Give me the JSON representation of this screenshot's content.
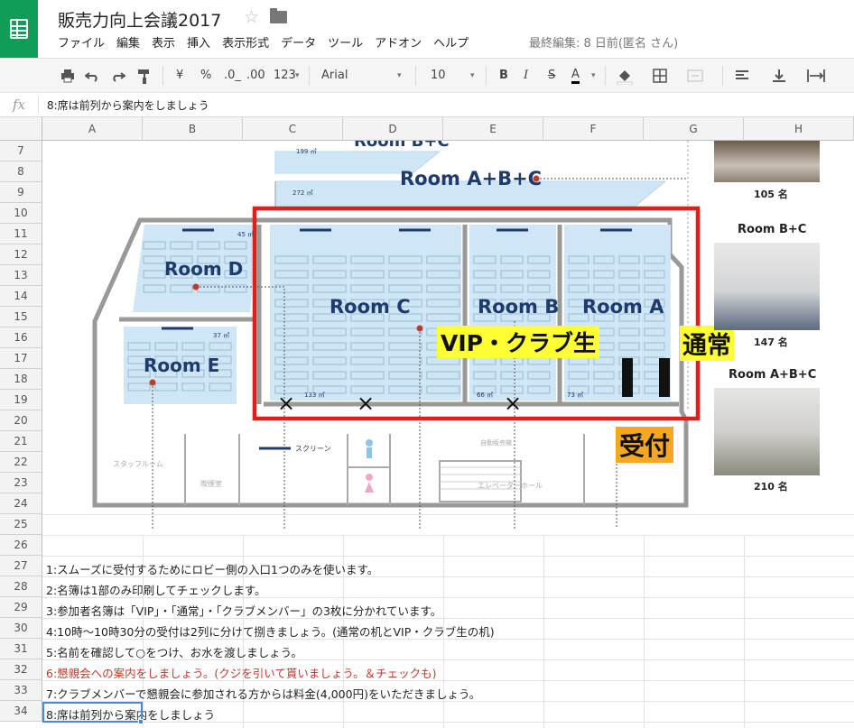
{
  "app": {
    "doc_title": "販売力向上会議2017",
    "menu": [
      "ファイル",
      "編集",
      "表示",
      "挿入",
      "表示形式",
      "データ",
      "ツール",
      "アドオン",
      "ヘルプ"
    ],
    "last_edit": "最終編集: 8 日前(匿名 さん)"
  },
  "toolbar": {
    "currency": "¥",
    "percent": "%",
    "dec_less": ".0_",
    "dec_more": ".00",
    "format_more": "123",
    "font": "Arial",
    "size": "10",
    "bold": "B",
    "italic": "I",
    "strike": "S",
    "text_color": "A"
  },
  "formula_bar": {
    "fx": "fx",
    "value": "8:席は前列から案内をしましょう"
  },
  "columns": [
    "A",
    "B",
    "C",
    "D",
    "E",
    "F",
    "G",
    "H"
  ],
  "rows": [
    "7",
    "8",
    "9",
    "10",
    "11",
    "12",
    "13",
    "14",
    "15",
    "16",
    "17",
    "18",
    "19",
    "20",
    "21",
    "22",
    "23",
    "24",
    "25",
    "26",
    "27",
    "28",
    "29",
    "30",
    "31",
    "32",
    "33",
    "34"
  ],
  "notes": [
    "1:スムーズに受付するためにロビー側の入口1つのみを使います。",
    "2:名簿は1部のみ印刷してチェックします。",
    "3:参加者名簿は「VIP」・「通常」・「クラブメンバー」の3枚に分かれています。",
    "4:10時～10時30分の受付は2列に分けて捌きましょう。(通常の机とVIP・クラブ生の机)",
    "5:名前を確認して○をつけ、お水を渡しましょう。",
    "6:懇親会への案内をしましょう。(クジを引いて貰いましょう。＆チェックも)",
    "7:クラブメンバーで懇親会に参加される方からは料金(4,000円)をいただきましょう。",
    "8:席は前列から案内をしましょう"
  ],
  "floorplan": {
    "room_top_partial": "Room B+C",
    "room_top_partial_size": "199 ㎡",
    "room_abc": "Room A+B+C",
    "room_abc_size": "272 ㎡",
    "room_d": "Room D",
    "room_d_size": "45 ㎡",
    "room_e": "Room E",
    "room_e_size": "37 ㎡",
    "room_c": "Room C",
    "room_c_size": "133 ㎡",
    "room_b": "Room B",
    "room_b_size": "66 ㎡",
    "room_a": "Room A",
    "room_a_size": "73 ㎡",
    "vip_label": "VIP・クラブ生",
    "normal_label": "通常",
    "reception_label": "受付",
    "screen_legend": "スクリーン",
    "staff_room": "スタッフルーム",
    "smoking_room": "喫煙室",
    "elevator_hall": "エレベーターホール",
    "vending": "自動販売機",
    "x_mark": "×"
  },
  "photos": {
    "cap1": "105 名",
    "title2": "Room B+C",
    "cap2": "147 名",
    "title3": "Room A+B+C",
    "cap3": "210 名"
  },
  "colors": {
    "accent": "#0f9d58",
    "room_fill": "#cfe6f7",
    "highlight_red": "#e31c1c",
    "label_yellow": "#ffff33",
    "label_orange": "#f5a623"
  }
}
